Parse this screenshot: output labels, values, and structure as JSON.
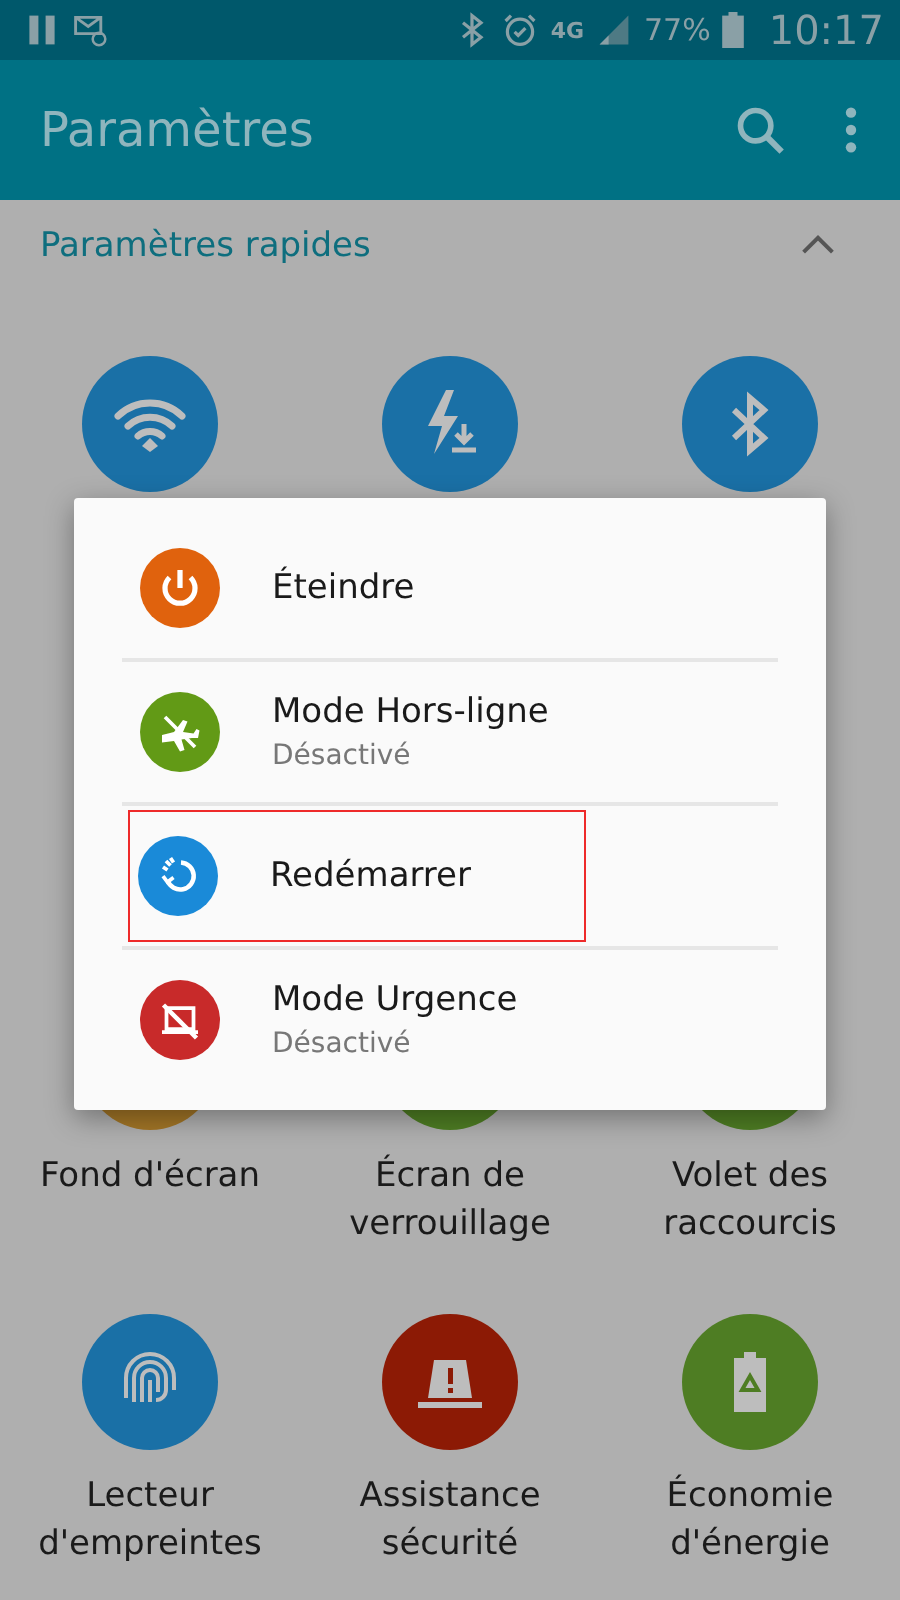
{
  "status_bar": {
    "network": "4G",
    "battery": "77%",
    "time": "10:17"
  },
  "app_bar": {
    "title": "Paramètres"
  },
  "section": {
    "title": "Paramètres rapides",
    "expanded": true
  },
  "top_tiles": [
    {
      "kind": "wifi",
      "color": "#1a70a6"
    },
    {
      "kind": "flash",
      "color": "#1a70a6"
    },
    {
      "kind": "bluetooth",
      "color": "#1a70a6"
    }
  ],
  "lower_tiles": [
    {
      "kind": "covered",
      "color": "#a27526",
      "label": "Fond d'écran"
    },
    {
      "kind": "covered",
      "color": "#4e7d23",
      "label": "Écran de verrouillage"
    },
    {
      "kind": "covered",
      "color": "#4e7d23",
      "label": "Volet des raccourcis"
    },
    {
      "kind": "fingerprint",
      "color": "#1a70a6",
      "label": "Lecteur d'empreintes"
    },
    {
      "kind": "alarm",
      "color": "#8c1a05",
      "label": "Assistance sécurité"
    },
    {
      "kind": "battery",
      "color": "#4e7d23",
      "label": "Économie d'énergie"
    }
  ],
  "power_menu": [
    {
      "kind": "power",
      "color": "#e0620d",
      "label": "Éteindre",
      "highlighted": false
    },
    {
      "kind": "airplane",
      "color": "#629a16",
      "label": "Mode Hors-ligne",
      "subtitle": "Désactivé",
      "highlighted": false
    },
    {
      "kind": "restart",
      "color": "#1a8ad8",
      "label": "Redémarrer",
      "highlighted": true
    },
    {
      "kind": "emergency",
      "color": "#c82a2a",
      "label": "Mode Urgence",
      "subtitle": "Désactivé",
      "highlighted": false
    }
  ]
}
